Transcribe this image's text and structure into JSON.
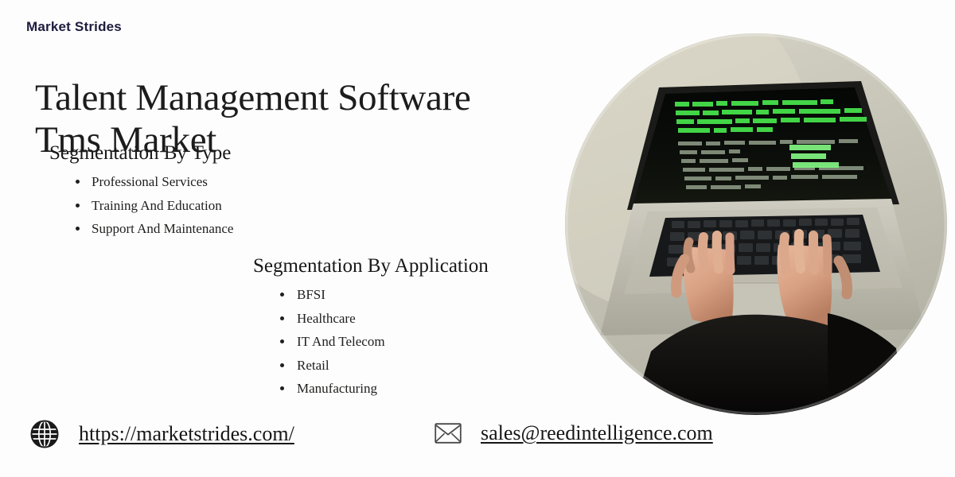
{
  "brand": {
    "name": "Market Strides"
  },
  "title": {
    "line1": "Talent Management Software",
    "line2": "Tms Market"
  },
  "segmentation_type": {
    "heading": "Segmentation By Type",
    "items": [
      "Professional Services",
      "Training And Education",
      "Support And Maintenance"
    ]
  },
  "segmentation_application": {
    "heading": "Segmentation By Application",
    "items": [
      "BFSI",
      "Healthcare",
      "IT And Telecom",
      "Retail",
      "Manufacturing"
    ]
  },
  "footer": {
    "website": "https://marketstrides.com/",
    "email": "sales@reedintelligence.com",
    "website_icon": "globe-icon",
    "email_icon": "envelope-icon"
  },
  "photo": {
    "alt": "Overhead view of hands typing on a laptop with green code on a dark screen",
    "shape": "circle"
  },
  "colors": {
    "background": "#fdfdfd",
    "brand_text": "#1d1c3f",
    "title_text": "#1c1c1c",
    "body_text": "#20201f",
    "screen_code_green": "#3ddc3d",
    "screen_background": "#0a0c08",
    "laptop_body": "#b9b7ad",
    "backdrop": "#cfcdc0"
  }
}
